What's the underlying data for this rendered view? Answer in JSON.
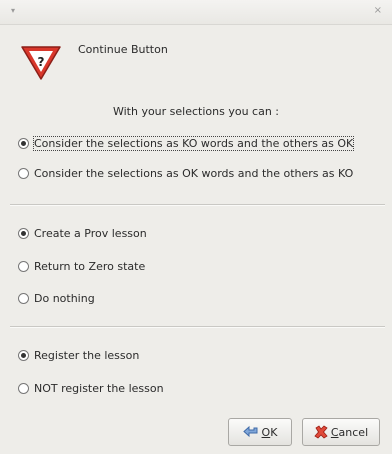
{
  "window": {
    "menu_glyph": "▾",
    "close_glyph": "×"
  },
  "header": {
    "title": "Continue Button",
    "icon": "warning-question-icon"
  },
  "intro": "With your selections you can :",
  "group_words": {
    "options": [
      {
        "label": "Consider the selections as KO words and the others as OK",
        "selected": true,
        "focused": true
      },
      {
        "label": "Consider the selections as OK words and the others as KO",
        "selected": false
      }
    ]
  },
  "group_lesson": {
    "options": [
      {
        "label": "Create a Prov lesson",
        "selected": true
      },
      {
        "label": "Return to Zero state",
        "selected": false
      },
      {
        "label": "Do nothing",
        "selected": false
      }
    ]
  },
  "group_register": {
    "options": [
      {
        "label": "Register the lesson",
        "selected": true
      },
      {
        "label": "NOT register the lesson",
        "selected": false
      }
    ]
  },
  "buttons": {
    "ok": {
      "mnemonic": "O",
      "rest": "K",
      "icon": "ok-arrow-icon"
    },
    "cancel": {
      "mnemonic": "C",
      "rest": "ancel",
      "icon": "cancel-x-icon"
    }
  },
  "colors": {
    "background": "#eeede9",
    "warning_red": "#d9372b",
    "cancel_red": "#cc2a2a",
    "ok_blue": "#4a78b8"
  }
}
